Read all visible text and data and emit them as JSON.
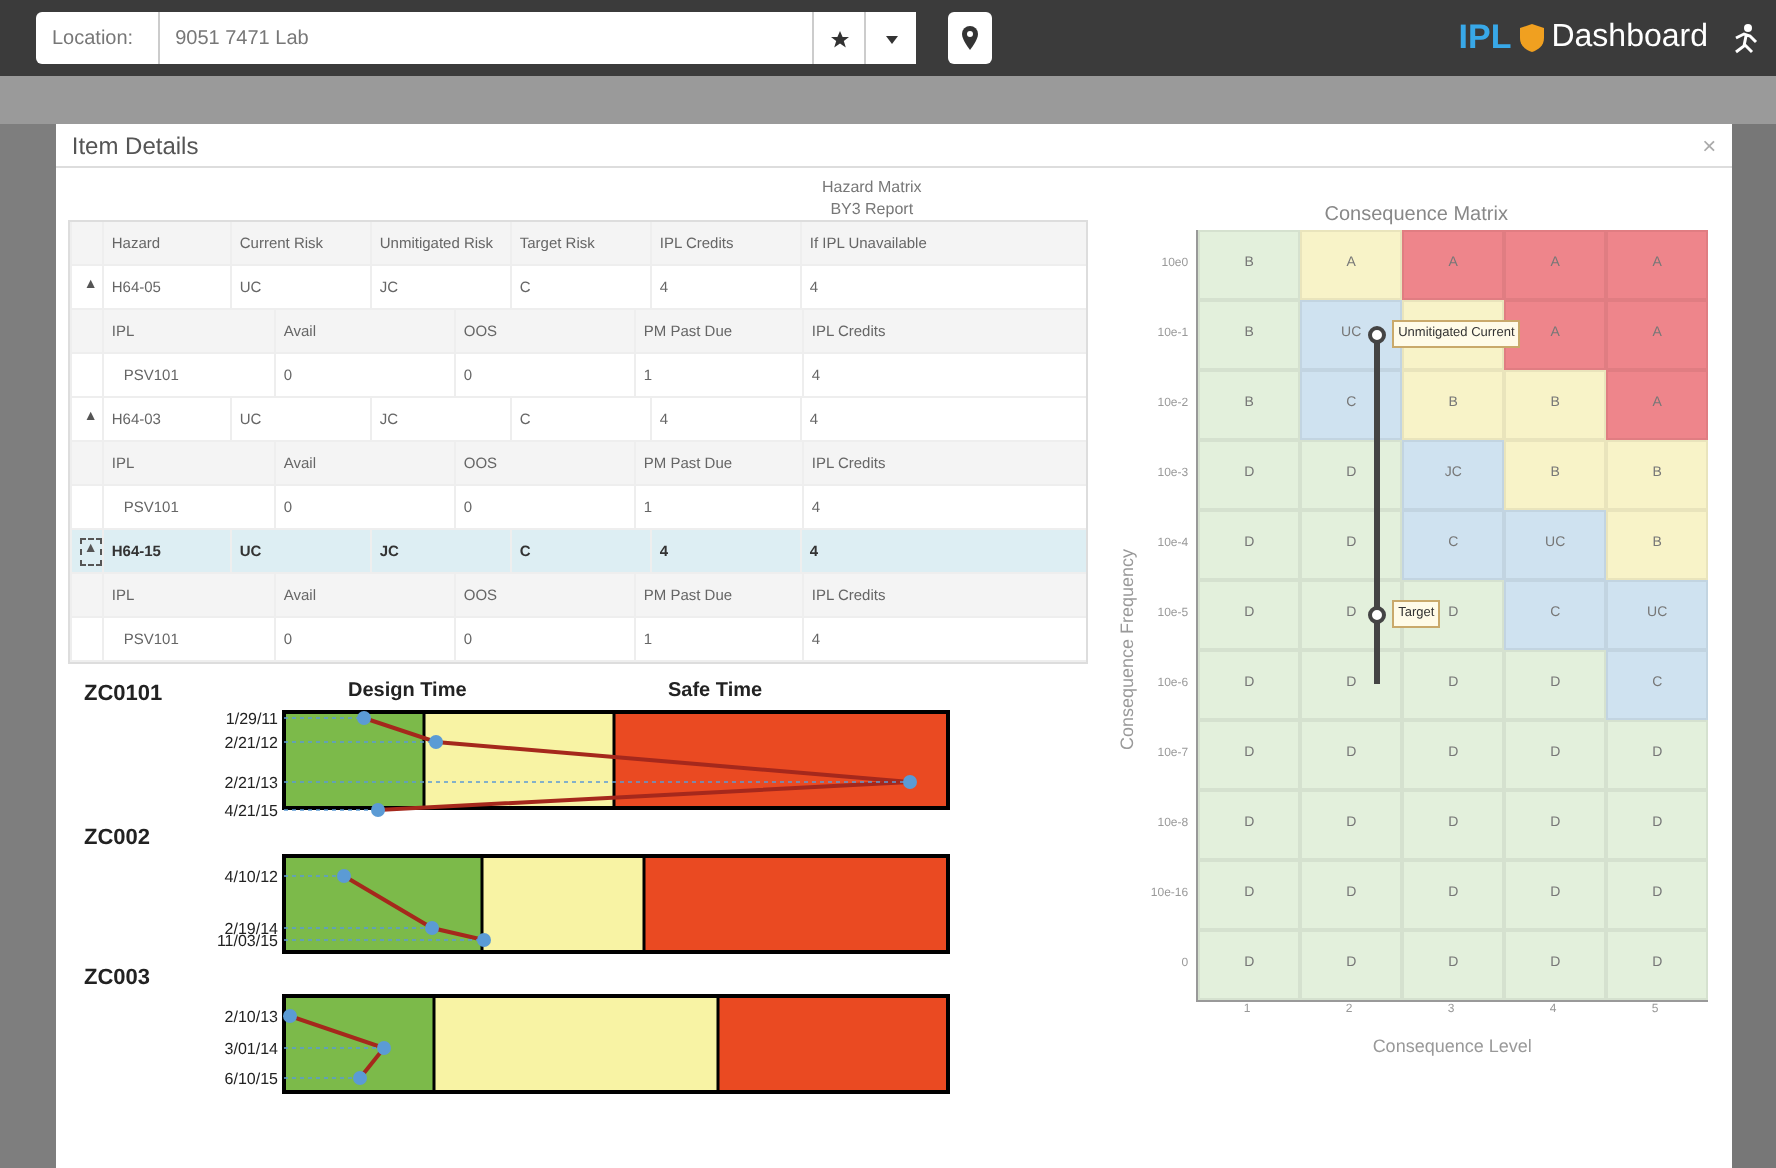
{
  "top_bar": {
    "location_label": "Location:",
    "location_value": "9051 7471 Lab",
    "brand": "IPL",
    "title": "Dashboard"
  },
  "dialog": {
    "title": "Item Details",
    "close": "×"
  },
  "report": {
    "title": "Hazard Matrix",
    "subtitle": "BY3 Report"
  },
  "hazard_table": {
    "columns": [
      "Hazard",
      "Current Risk",
      "Unmitigated Risk",
      "Target Risk",
      "IPL Credits",
      "If IPL Unavailable"
    ],
    "rows": [
      {
        "toggle": "▲",
        "cells": [
          "H64-05",
          "UC",
          "JC",
          "C",
          "4",
          "4"
        ],
        "selected": false,
        "expanded": true,
        "sub_columns": [
          "IPL",
          "Avail",
          "OOS",
          "PM Past Due",
          "IPL Credits"
        ],
        "ipls": [
          [
            "PSV101",
            "0",
            "0",
            "1",
            "4"
          ]
        ]
      },
      {
        "toggle": "▲",
        "cells": [
          "H64-03",
          "UC",
          "JC",
          "C",
          "4",
          "4"
        ],
        "selected": false,
        "expanded": true,
        "sub_columns": [
          "IPL",
          "Avail",
          "OOS",
          "PM Past Due",
          "IPL Credits"
        ],
        "ipls": [
          [
            "PSV101",
            "0",
            "0",
            "1",
            "4"
          ]
        ]
      },
      {
        "toggle": "▲",
        "cells": [
          "H64-15",
          "UC",
          "JC",
          "C",
          "4",
          "4"
        ],
        "selected": true,
        "expanded": true,
        "sub_columns": [
          "IPL",
          "Avail",
          "OOS",
          "PM Past Due",
          "IPL Credits"
        ],
        "ipls": [
          [
            "PSV101",
            "0",
            "0",
            "1",
            "4"
          ]
        ]
      }
    ]
  },
  "timeline": {
    "design_label": "Design Time",
    "safe_label": "Safe Time",
    "items": [
      {
        "name": "ZC0101",
        "dates": [
          "1/29/11",
          "2/21/12",
          "2/21/13",
          "4/21/15"
        ]
      },
      {
        "name": "ZC002",
        "dates": [
          "4/10/12",
          "2/19/14",
          "11/03/15"
        ]
      },
      {
        "name": "ZC003",
        "dates": [
          "2/10/13",
          "3/01/14",
          "6/10/15"
        ]
      }
    ]
  },
  "matrix": {
    "title": "Consequence Matrix",
    "xlabel": "Consequence Level",
    "ylabel": "Consequence Frequency",
    "row_labels": [
      "10e0",
      "10e-1",
      "10e-2",
      "10e-3",
      "10e-4",
      "10e-5",
      "10e-6",
      "10e-7",
      "10e-8",
      "10e-16",
      "0"
    ],
    "col_labels": [
      "1",
      "2",
      "3",
      "4",
      "5"
    ],
    "rows": [
      [
        {
          "text": "B",
          "color": "#e3f0dc"
        },
        {
          "text": "A",
          "color": "#f8f3c8"
        },
        {
          "text": "A",
          "color": "#ee858b"
        },
        {
          "text": "A",
          "color": "#ee858b"
        },
        {
          "text": "A",
          "color": "#ee858b"
        }
      ],
      [
        {
          "text": "B",
          "color": "#e3f0dc"
        },
        {
          "text": "UC",
          "color": "#cfe2f0"
        },
        {
          "text": "",
          "color": "#f8f3c8"
        },
        {
          "text": "A",
          "color": "#ee858b"
        },
        {
          "text": "A",
          "color": "#ee858b"
        }
      ],
      [
        {
          "text": "B",
          "color": "#e3f0dc"
        },
        {
          "text": "C",
          "color": "#cfe2f0"
        },
        {
          "text": "B",
          "color": "#f8f3c8"
        },
        {
          "text": "B",
          "color": "#f8f3c8"
        },
        {
          "text": "A",
          "color": "#ee858b"
        }
      ],
      [
        {
          "text": "D",
          "color": "#e3f0dc"
        },
        {
          "text": "D",
          "color": "#e3f0dc"
        },
        {
          "text": "JC",
          "color": "#cfe2f0"
        },
        {
          "text": "B",
          "color": "#f8f3c8"
        },
        {
          "text": "B",
          "color": "#f8f3c8"
        }
      ],
      [
        {
          "text": "D",
          "color": "#e3f0dc"
        },
        {
          "text": "D",
          "color": "#e3f0dc"
        },
        {
          "text": "C",
          "color": "#cfe2f0"
        },
        {
          "text": "UC",
          "color": "#cfe2f0"
        },
        {
          "text": "B",
          "color": "#f8f3c8"
        }
      ],
      [
        {
          "text": "D",
          "color": "#e3f0dc"
        },
        {
          "text": "D",
          "color": "#e3f0dc"
        },
        {
          "text": "D",
          "color": "#e3f0dc"
        },
        {
          "text": "C",
          "color": "#cfe2f0"
        },
        {
          "text": "UC",
          "color": "#cfe2f0"
        }
      ],
      [
        {
          "text": "D",
          "color": "#e3f0dc"
        },
        {
          "text": "D",
          "color": "#e3f0dc"
        },
        {
          "text": "D",
          "color": "#e3f0dc"
        },
        {
          "text": "D",
          "color": "#e3f0dc"
        },
        {
          "text": "C",
          "color": "#cfe2f0"
        }
      ],
      [
        {
          "text": "D",
          "color": "#e3f0dc"
        },
        {
          "text": "D",
          "color": "#e3f0dc"
        },
        {
          "text": "D",
          "color": "#e3f0dc"
        },
        {
          "text": "D",
          "color": "#e3f0dc"
        },
        {
          "text": "D",
          "color": "#e3f0dc"
        }
      ],
      [
        {
          "text": "D",
          "color": "#e3f0dc"
        },
        {
          "text": "D",
          "color": "#e3f0dc"
        },
        {
          "text": "D",
          "color": "#e3f0dc"
        },
        {
          "text": "D",
          "color": "#e3f0dc"
        },
        {
          "text": "D",
          "color": "#e3f0dc"
        }
      ],
      [
        {
          "text": "D",
          "color": "#e3f0dc"
        },
        {
          "text": "D",
          "color": "#e3f0dc"
        },
        {
          "text": "D",
          "color": "#e3f0dc"
        },
        {
          "text": "D",
          "color": "#e3f0dc"
        },
        {
          "text": "D",
          "color": "#e3f0dc"
        }
      ],
      [
        {
          "text": "D",
          "color": "#e3f0dc"
        },
        {
          "text": "D",
          "color": "#e3f0dc"
        },
        {
          "text": "D",
          "color": "#e3f0dc"
        },
        {
          "text": "D",
          "color": "#e3f0dc"
        },
        {
          "text": "D",
          "color": "#e3f0dc"
        }
      ]
    ],
    "markers": [
      {
        "label": "Unmitigated Current"
      },
      {
        "label": "Target"
      }
    ]
  }
}
